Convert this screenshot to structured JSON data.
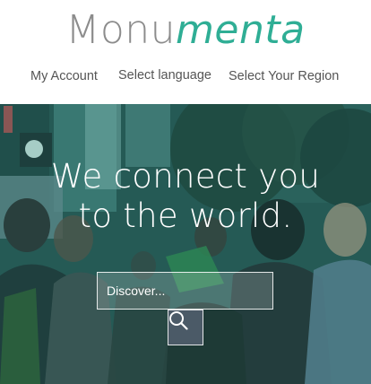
{
  "brand": {
    "logo_plain": "Monu",
    "logo_accent": "menta"
  },
  "nav": {
    "my_account": "My Account",
    "select_language": "Select language",
    "select_region": "Select Your Region"
  },
  "hero": {
    "headline_line1": "We connect you",
    "headline_line2": "to the world."
  },
  "search": {
    "placeholder": "Discover...",
    "value": "",
    "button_icon": "search-icon"
  },
  "colors": {
    "brand_accent": "#2fae95",
    "logo_gray": "#8c8c8c",
    "search_button": "#4b5a67"
  }
}
